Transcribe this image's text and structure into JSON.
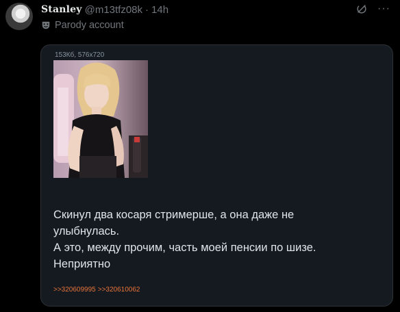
{
  "author": {
    "display_name": "Stanley",
    "handle": "@m13tfz08k",
    "separator": "·",
    "time": "14h",
    "label": "Parody account",
    "label_icon": "theater-mask-icon"
  },
  "actions": {
    "grok_icon": "grok-icon",
    "more_label": "···"
  },
  "media": {
    "file_info": "153Кб, 576x720",
    "text_lines": [
      "Скинул два косаря стримерше, а она даже не",
      "улыбнулась.",
      "А это, между прочим, часть моей пенсии по шизе.",
      "Неприятно"
    ],
    "reply_links": [
      ">>320609995",
      ">>320610062"
    ],
    "reply_color": "#e8733a"
  },
  "colors": {
    "background": "#000000",
    "card_background": "#141a20",
    "muted": "#71767b",
    "text": "#e7e9ea"
  }
}
